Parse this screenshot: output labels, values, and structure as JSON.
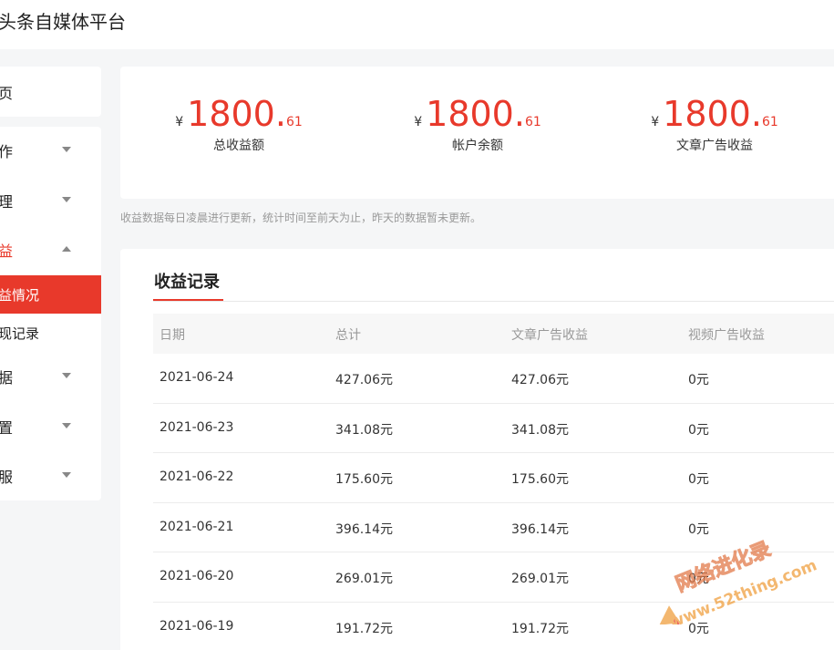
{
  "app": {
    "title": "头条自媒体平台"
  },
  "sidebar": {
    "home": "页",
    "items": [
      {
        "label": "作",
        "expanded": false
      },
      {
        "label": "理",
        "expanded": false
      },
      {
        "label": "益",
        "expanded": true
      },
      {
        "label": "据",
        "expanded": false
      },
      {
        "label": "置",
        "expanded": false
      },
      {
        "label": "服",
        "expanded": false
      }
    ],
    "sub_items": [
      {
        "label": "益情况",
        "active": true
      },
      {
        "label": "现记录",
        "active": false
      }
    ]
  },
  "summary": {
    "currency": "¥",
    "stats": [
      {
        "int": "1800",
        "dot": ".",
        "dec": "61",
        "label": "总收益额"
      },
      {
        "int": "1800",
        "dot": ".",
        "dec": "61",
        "label": "帐户余额"
      },
      {
        "int": "1800",
        "dot": ".",
        "dec": "61",
        "label": "文章广告收益"
      }
    ]
  },
  "notice": "收益数据每日凌晨进行更新，统计时间至前天为止，昨天的数据暂未更新。",
  "records": {
    "title": "收益记录",
    "columns": [
      "日期",
      "总计",
      "文章广告收益",
      "视频广告收益"
    ],
    "rows": [
      [
        "2021-06-24",
        "427.06元",
        "427.06元",
        "0元"
      ],
      [
        "2021-06-23",
        "341.08元",
        "341.08元",
        "0元"
      ],
      [
        "2021-06-22",
        "175.60元",
        "175.60元",
        "0元"
      ],
      [
        "2021-06-21",
        "396.14元",
        "396.14元",
        "0元"
      ],
      [
        "2021-06-20",
        "269.01元",
        "269.01元",
        "0元"
      ],
      [
        "2021-06-19",
        "191.72元",
        "191.72元",
        "0元"
      ]
    ]
  },
  "watermark": {
    "line1": "网络进化录",
    "line2": "www.52thing.com"
  },
  "colors": {
    "accent": "#e8392b",
    "muted": "#999999",
    "background": "#f5f6f7"
  }
}
